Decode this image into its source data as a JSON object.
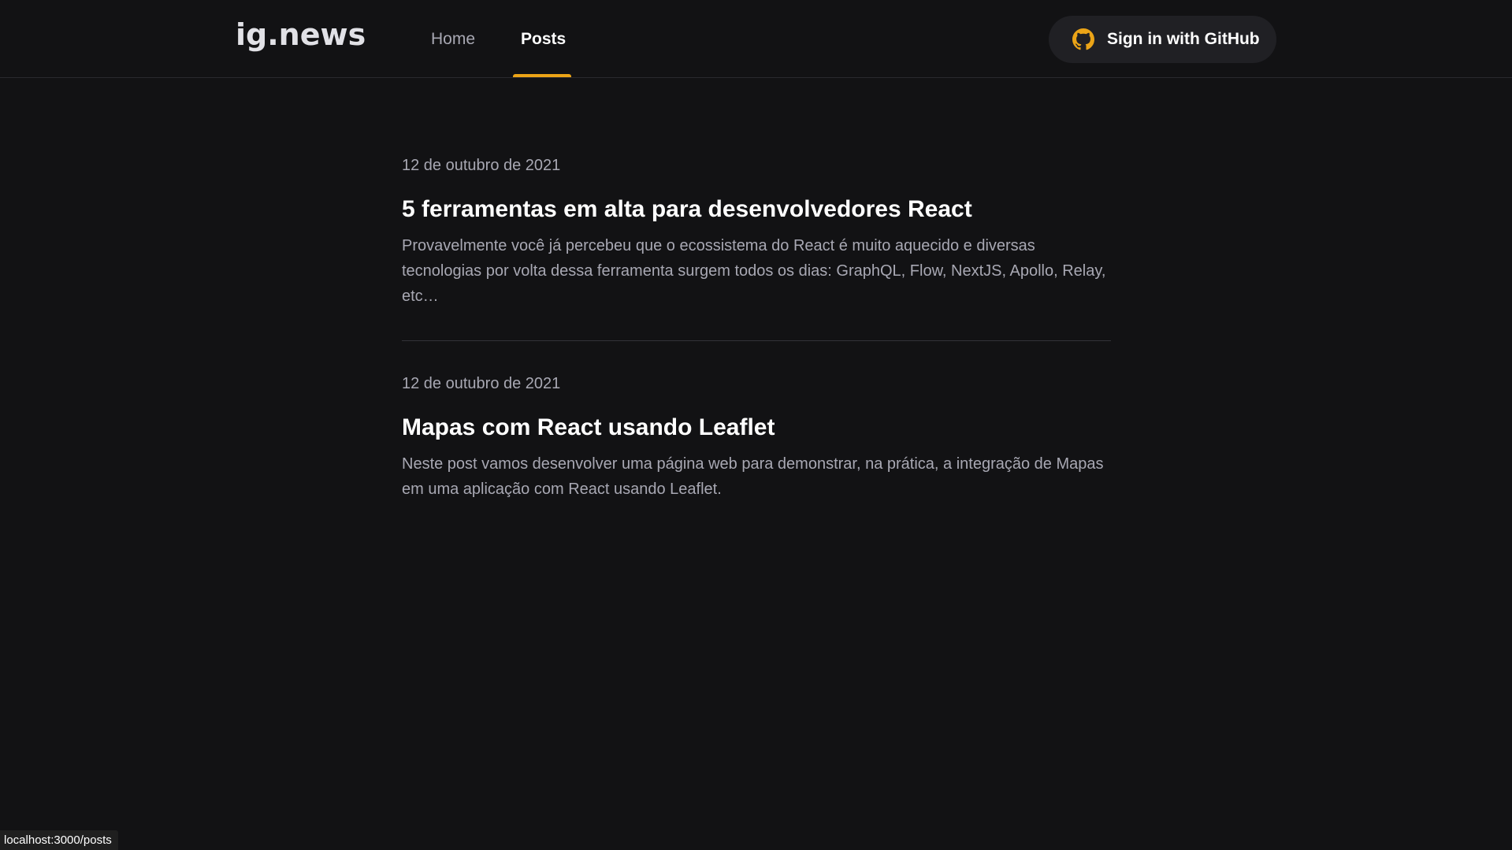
{
  "header": {
    "logo": "ig.news",
    "nav": [
      {
        "label": "Home",
        "active": false
      },
      {
        "label": "Posts",
        "active": true
      }
    ],
    "signin_label": "Sign in with GitHub",
    "signin_icon": "github-icon",
    "accent_color": "#eba417"
  },
  "posts": [
    {
      "date": "12 de outubro de 2021",
      "title": "5 ferramentas em alta para desenvolvedores React",
      "excerpt": "Provavelmente você já percebeu que o ecossistema do React é muito aquecido e diversas tecnologias por volta dessa ferramenta surgem todos os dias: GraphQL, Flow, NextJS, Apollo, Relay, etc…"
    },
    {
      "date": "12 de outubro de 2021",
      "title": "Mapas com React usando Leaflet",
      "excerpt": "Neste post vamos desenvolver uma página web para demonstrar, na prática, a integração de Mapas em uma aplicação com React usando Leaflet."
    }
  ],
  "status_url": "localhost:3000/posts"
}
